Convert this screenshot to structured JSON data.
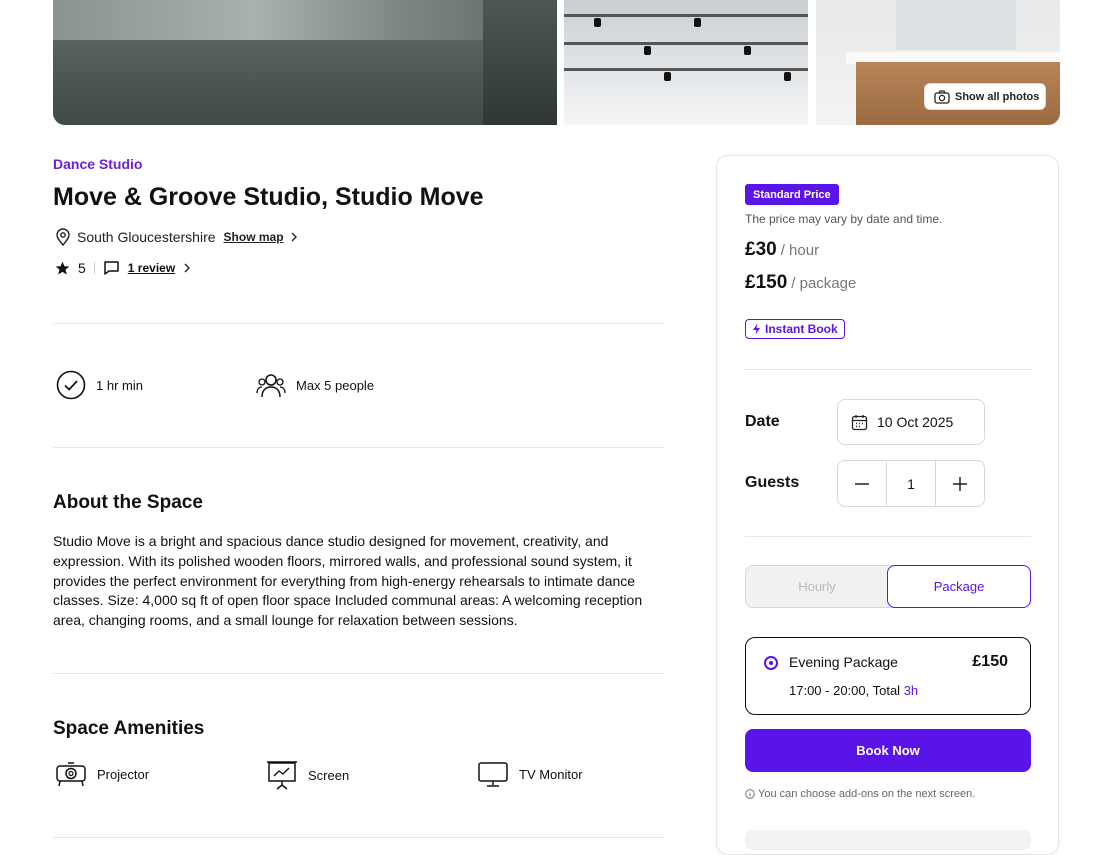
{
  "gallery": {
    "show_all_label": "Show all photos"
  },
  "listing": {
    "category": "Dance Studio",
    "title": "Move & Groove Studio, Studio Move",
    "location": "South Gloucestershire",
    "show_map_label": "Show map",
    "rating": "5",
    "review_label": "1 review"
  },
  "features": [
    {
      "label": "1 hr min",
      "icon": "check-circle-icon"
    },
    {
      "label": "Max 5 people",
      "icon": "people-icon"
    }
  ],
  "about": {
    "heading": "About the Space",
    "text": "Studio Move is a bright and spacious dance studio designed for movement, creativity, and expression. With its polished wooden floors, mirrored walls, and professional sound system, it provides the perfect environment for everything from high-energy rehearsals to intimate dance classes. Size: 4,000 sq ft of open floor space Included communal areas: A welcoming reception area, changing rooms, and a small lounge for relaxation between sessions."
  },
  "amenities": {
    "heading": "Space Amenities",
    "items": [
      {
        "label": "Projector",
        "icon": "projector-icon"
      },
      {
        "label": "Screen",
        "icon": "presentation-screen-icon"
      },
      {
        "label": "TV Monitor",
        "icon": "monitor-icon"
      }
    ]
  },
  "booking": {
    "badge": "Standard Price",
    "note": "The price may vary by date and time.",
    "price_hour": "£30",
    "price_hour_unit": "/ hour",
    "price_package": "£150",
    "price_package_unit": "/ package",
    "instant_label": "Instant Book",
    "date_label": "Date",
    "date_value": "10 Oct 2025",
    "guests_label": "Guests",
    "guests_value": "1",
    "tab_hourly": "Hourly",
    "tab_package": "Package",
    "package_name": "Evening Package",
    "package_price": "£150",
    "package_time": "17:00 - 20:00, Total",
    "package_total": "3h",
    "book_label": "Book Now",
    "footnote": "You can choose add-ons on the next screen.",
    "accent": "#5b14e8"
  }
}
